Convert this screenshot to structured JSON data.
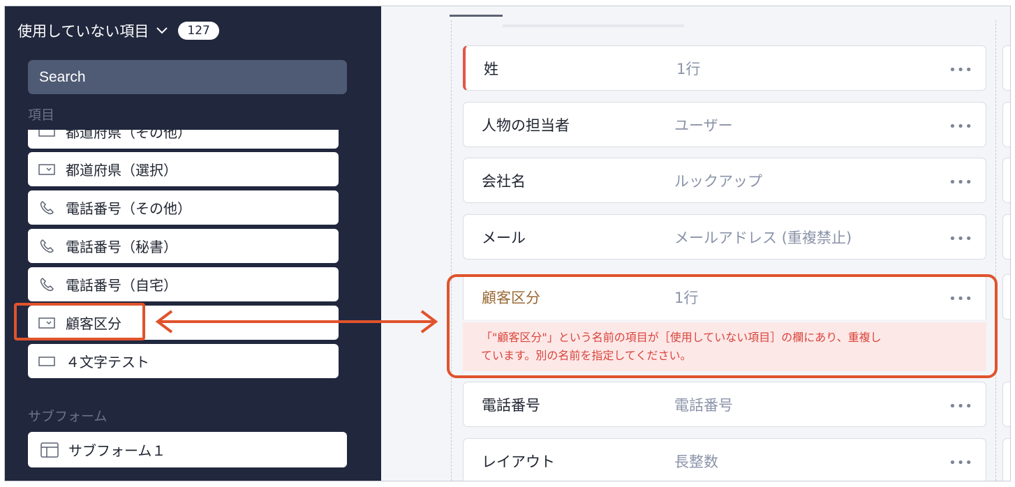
{
  "sidebar": {
    "header_title": "使用していない項目",
    "badge_count": "127",
    "search_placeholder": "Search",
    "section_fields_label": "項目",
    "items": [
      {
        "label": "都道府県（その他）",
        "icon": "input-box-icon"
      },
      {
        "label": "都道府県（選択）",
        "icon": "dropdown-box-icon"
      },
      {
        "label": "電話番号（その他）",
        "icon": "phone-icon"
      },
      {
        "label": "電話番号（秘書）",
        "icon": "phone-icon"
      },
      {
        "label": "電話番号（自宅）",
        "icon": "phone-icon"
      },
      {
        "label": "顧客区分",
        "icon": "dropdown-box-icon"
      },
      {
        "label": "４文字テスト",
        "icon": "input-box-icon"
      }
    ],
    "section_subform_label": "サブフォーム",
    "subform_item": {
      "label": "サブフォーム１",
      "icon": "table-icon"
    }
  },
  "main": {
    "fields": [
      {
        "name": "姓",
        "type": "1行",
        "more": "•••"
      },
      {
        "name": "人物の担当者",
        "type": "ユーザー",
        "more": "•••"
      },
      {
        "name": "会社名",
        "type": "ルックアップ",
        "more": "•••"
      },
      {
        "name": "メール",
        "type": "メールアドレス (重複禁止)",
        "more": "•••"
      },
      {
        "name": "顧客区分",
        "type": "1行",
        "more": "•••"
      },
      {
        "name": "電話番号",
        "type": "電話番号",
        "more": "•••"
      },
      {
        "name": "レイアウト",
        "type": "長整数",
        "more": "•••"
      }
    ],
    "error_line1": "「\"顧客区分\"」という名前の項目が［使用していない項目］の欄にあり、重複し",
    "error_line2": "ています。別の名前を指定してください。"
  },
  "colors": {
    "sidebar_bg": "#21273d",
    "search_bg": "#4f5a74",
    "highlight": "#e0532c",
    "error_text": "#d9453b",
    "error_bg": "#fde8e8",
    "required_marker": "#e2574c"
  }
}
